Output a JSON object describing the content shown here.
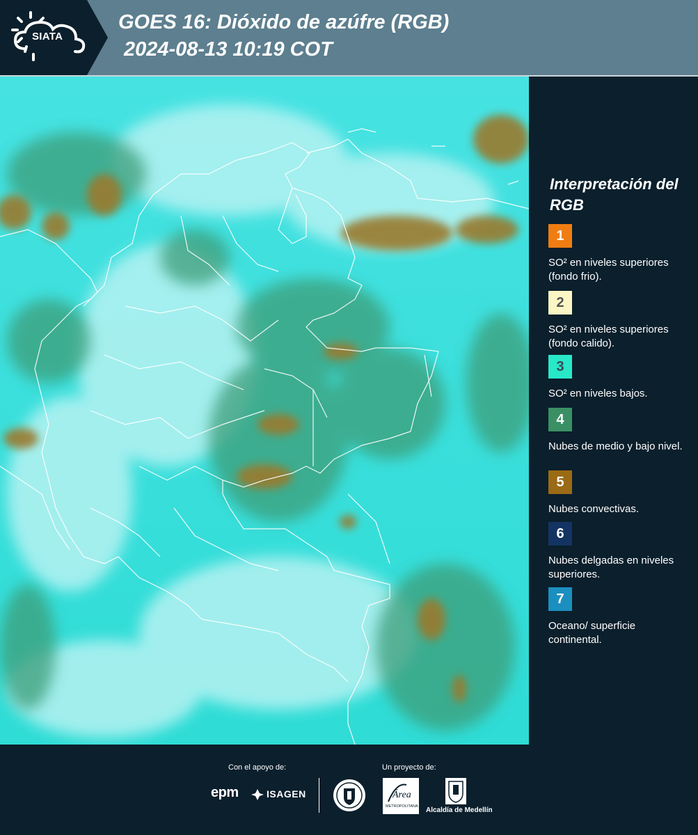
{
  "header": {
    "logo_text": "SIATA",
    "title_line1": "GOES 16: Dióxido de azúfre (RGB)",
    "title_line2": "2024-08-13 10:19 COT"
  },
  "map": {
    "background_color": "#3fe0e0",
    "cloud_colors": {
      "convective": "#9a7a2e",
      "mid_low": "#3d9d78",
      "thin_high": "#b7f3f3"
    },
    "border_color": "#ffffff"
  },
  "legend": {
    "title": "Interpretación del RGB",
    "items": [
      {
        "number": "1",
        "color": "#f07d12",
        "number_color": "#ffffff",
        "label": "SO² en niveles superiores (fondo frio)."
      },
      {
        "number": "2",
        "color": "#fbf6c4",
        "number_color": "#555555",
        "label": "SO² en niveles superiores (fondo calido)."
      },
      {
        "number": "3",
        "color": "#28e8c8",
        "number_color": "#3a4a55",
        "label": "SO² en niveles bajos."
      },
      {
        "number": "4",
        "color": "#3a9064",
        "number_color": "#ffffff",
        "label": "Nubes de medio y bajo nivel."
      },
      {
        "number": "5",
        "color": "#9b6a15",
        "number_color": "#ffffff",
        "label": "Nubes convectivas."
      },
      {
        "number": "6",
        "color": "#133462",
        "number_color": "#ffffff",
        "label": "Nubes delgadas en niveles superiores."
      },
      {
        "number": "7",
        "color": "#1b8fc0",
        "number_color": "#ffffff",
        "label": "Oceano/ superficie continental."
      }
    ]
  },
  "footer": {
    "support_label": "Con el apoyo de:",
    "project_label": "Un proyecto de:",
    "sponsor1": "epm",
    "sponsor2": "ISAGEN",
    "partner_area_text": "Área",
    "partner_area_sub": "METROPOLITANA",
    "partner_alcaldia": "Alcaldía de Medellín"
  }
}
